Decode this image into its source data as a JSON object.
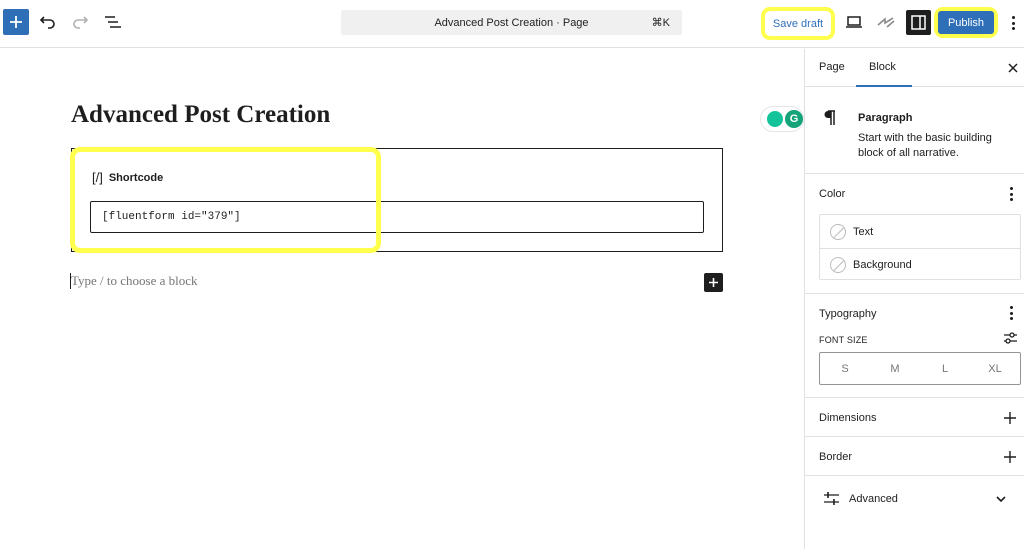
{
  "toolbar": {
    "command_bar_title": "Advanced Post Creation · Page",
    "command_bar_shortcut": "⌘K",
    "save_draft_label": "Save draft",
    "publish_label": "Publish"
  },
  "editor": {
    "post_title": "Advanced Post Creation",
    "shortcode_block": {
      "icon_text": "[/]",
      "label": "Shortcode",
      "value": "[fluentform id=\"379\"]"
    },
    "empty_block_placeholder": "Type / to choose a block",
    "grammarly_letter": "G"
  },
  "sidebar": {
    "tabs": [
      {
        "label": "Page",
        "active": false
      },
      {
        "label": "Block",
        "active": true
      }
    ],
    "block_card": {
      "title": "Paragraph",
      "description": "Start with the basic building block of all narrative."
    },
    "color_panel": {
      "title": "Color",
      "items": [
        "Text",
        "Background"
      ]
    },
    "typography_panel": {
      "title": "Typography",
      "font_size_label": "FONT SIZE",
      "sizes": [
        "S",
        "M",
        "L",
        "XL"
      ]
    },
    "dimensions_title": "Dimensions",
    "border_title": "Border",
    "advanced_title": "Advanced"
  },
  "colors": {
    "accent": "#2f6fb8",
    "highlight": "#ffff4d",
    "dark": "#1e1e1e",
    "border": "#e0e0e0"
  },
  "icons": [
    "plus-icon",
    "undo-icon",
    "redo-icon",
    "list-view-icon",
    "desktop-preview-icon",
    "jetpack-bolt-icon",
    "sidebar-toggle-icon",
    "kebab-menu-icon",
    "close-icon",
    "pilcrow-icon",
    "sliders-icon",
    "chevron-down-icon"
  ]
}
